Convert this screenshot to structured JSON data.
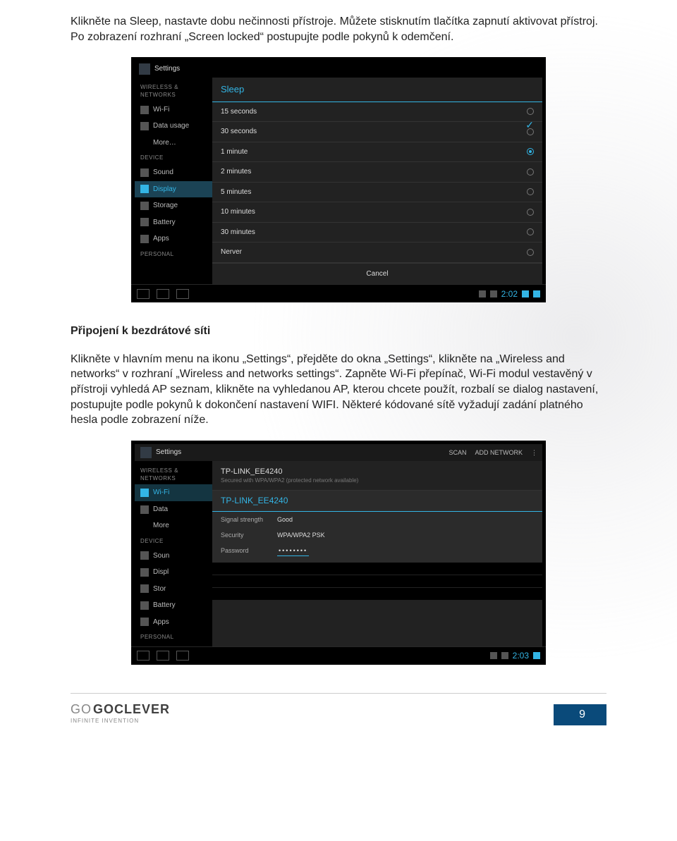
{
  "intro": "Klikněte na Sleep, nastavte dobu nečinnosti přístroje. Můžete stisknutím tlačítka zapnutí aktivovat přístroj. Po zobrazení rozhraní „Screen locked“ postupujte podle pokynů k odemčení.",
  "section_heading": "Připojení k bezdrátové síti",
  "section_text": "Klikněte v hlavním menu na ikonu „Settings“, přejděte do okna „Settings“, klikněte na „Wireless and networks“ v rozhraní „Wireless and networks settings“. Zapněte Wi-Fi přepínač, Wi-Fi modul vestavěný v přístroji vyhledá AP seznam, klikněte na vyhledanou AP, kterou chcete použít, rozbalí se dialog nastavení, postupujte podle pokynů k dokončení nastavení WIFI. Některé kódované sítě vyžadují zadání platného hesla podle zobrazení níže.",
  "scr1": {
    "settings": "Settings",
    "wireless_header": "WIRELESS & NETWORKS",
    "wifi": "Wi-Fi",
    "data_usage": "Data usage",
    "more": "More…",
    "device_header": "DEVICE",
    "sound": "Sound",
    "display": "Display",
    "storage": "Storage",
    "battery": "Battery",
    "apps": "Apps",
    "personal": "PERSONAL",
    "dialog_title": "Sleep",
    "options": [
      "15 seconds",
      "30 seconds",
      "1 minute",
      "2 minutes",
      "5 minutes",
      "10 minutes",
      "30 minutes",
      "Nerver"
    ],
    "selected_index": 2,
    "cancel": "Cancel",
    "clock": "2:02"
  },
  "scr2": {
    "settings": "Settings",
    "scan": "SCAN",
    "add_network": "ADD NETWORK",
    "wireless_header": "WIRELESS & NETWORKS",
    "wifi": "Wi-Fi",
    "data": "Data",
    "more": "More",
    "device_header": "DEVICE",
    "sound": "Soun",
    "display": "Displ",
    "storage": "Stor",
    "battery": "Battery",
    "apps": "Apps",
    "personal": "PERSONAL",
    "net_name": "TP-LINK_EE4240",
    "net_sub": "Secured with WPA/WPA2 (protected network available)",
    "dlg_title": "TP-LINK_EE4240",
    "signal_k": "Signal strength",
    "signal_v": "Good",
    "security_k": "Security",
    "security_v": "WPA/WPA2 PSK",
    "password_k": "Password",
    "password_v": "••••••••",
    "clock": "2:03"
  },
  "brand_prefix": "GO",
  "brand_name": "GOCLEVER",
  "brand_sub": "INFINITE INVENTION",
  "page_number": "9"
}
